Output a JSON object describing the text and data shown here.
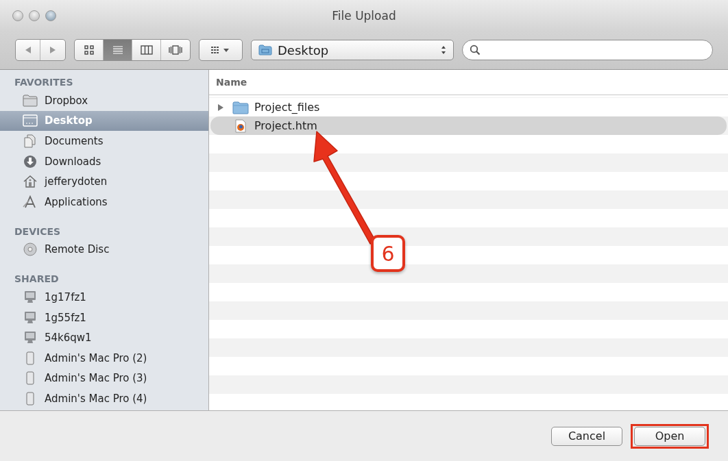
{
  "window": {
    "title": "File Upload"
  },
  "toolbar": {
    "view_modes": [
      {
        "kind": "icons",
        "selected": false
      },
      {
        "kind": "list",
        "selected": true
      },
      {
        "kind": "columns",
        "selected": false
      },
      {
        "kind": "coverflow",
        "selected": false
      }
    ],
    "location": "Desktop"
  },
  "sidebar": {
    "sections": [
      {
        "heading": "FAVORITES",
        "items": [
          {
            "label": "Dropbox",
            "kind": "folder",
            "selected": false
          },
          {
            "label": "Desktop",
            "kind": "desktop",
            "selected": true
          },
          {
            "label": "Documents",
            "kind": "documents",
            "selected": false
          },
          {
            "label": "Downloads",
            "kind": "downloads",
            "selected": false
          },
          {
            "label": "jefferydoten",
            "kind": "home",
            "selected": false
          },
          {
            "label": "Applications",
            "kind": "applications",
            "selected": false
          }
        ]
      },
      {
        "heading": "DEVICES",
        "items": [
          {
            "label": "Remote Disc",
            "kind": "disc",
            "selected": false
          }
        ]
      },
      {
        "heading": "SHARED",
        "items": [
          {
            "label": "1g17fz1",
            "kind": "computer",
            "selected": false
          },
          {
            "label": "1g55fz1",
            "kind": "computer",
            "selected": false
          },
          {
            "label": "54k6qw1",
            "kind": "computer",
            "selected": false
          },
          {
            "label": "Admin's Mac Pro (2)",
            "kind": "tower",
            "selected": false
          },
          {
            "label": "Admin's Mac Pro (3)",
            "kind": "tower",
            "selected": false
          },
          {
            "label": "Admin's Mac Pro (4)",
            "kind": "tower",
            "selected": false
          }
        ]
      }
    ]
  },
  "file_list": {
    "column": "Name",
    "rows": [
      {
        "name": "Project_files",
        "kind": "folder",
        "expanded": false,
        "selected": false
      },
      {
        "name": "Project.htm",
        "kind": "webpage",
        "selected": true
      }
    ]
  },
  "annotation": {
    "label": "6"
  },
  "buttons": [
    {
      "label": "Cancel",
      "highlighted": false
    },
    {
      "label": "Open",
      "highlighted": true
    }
  ]
}
